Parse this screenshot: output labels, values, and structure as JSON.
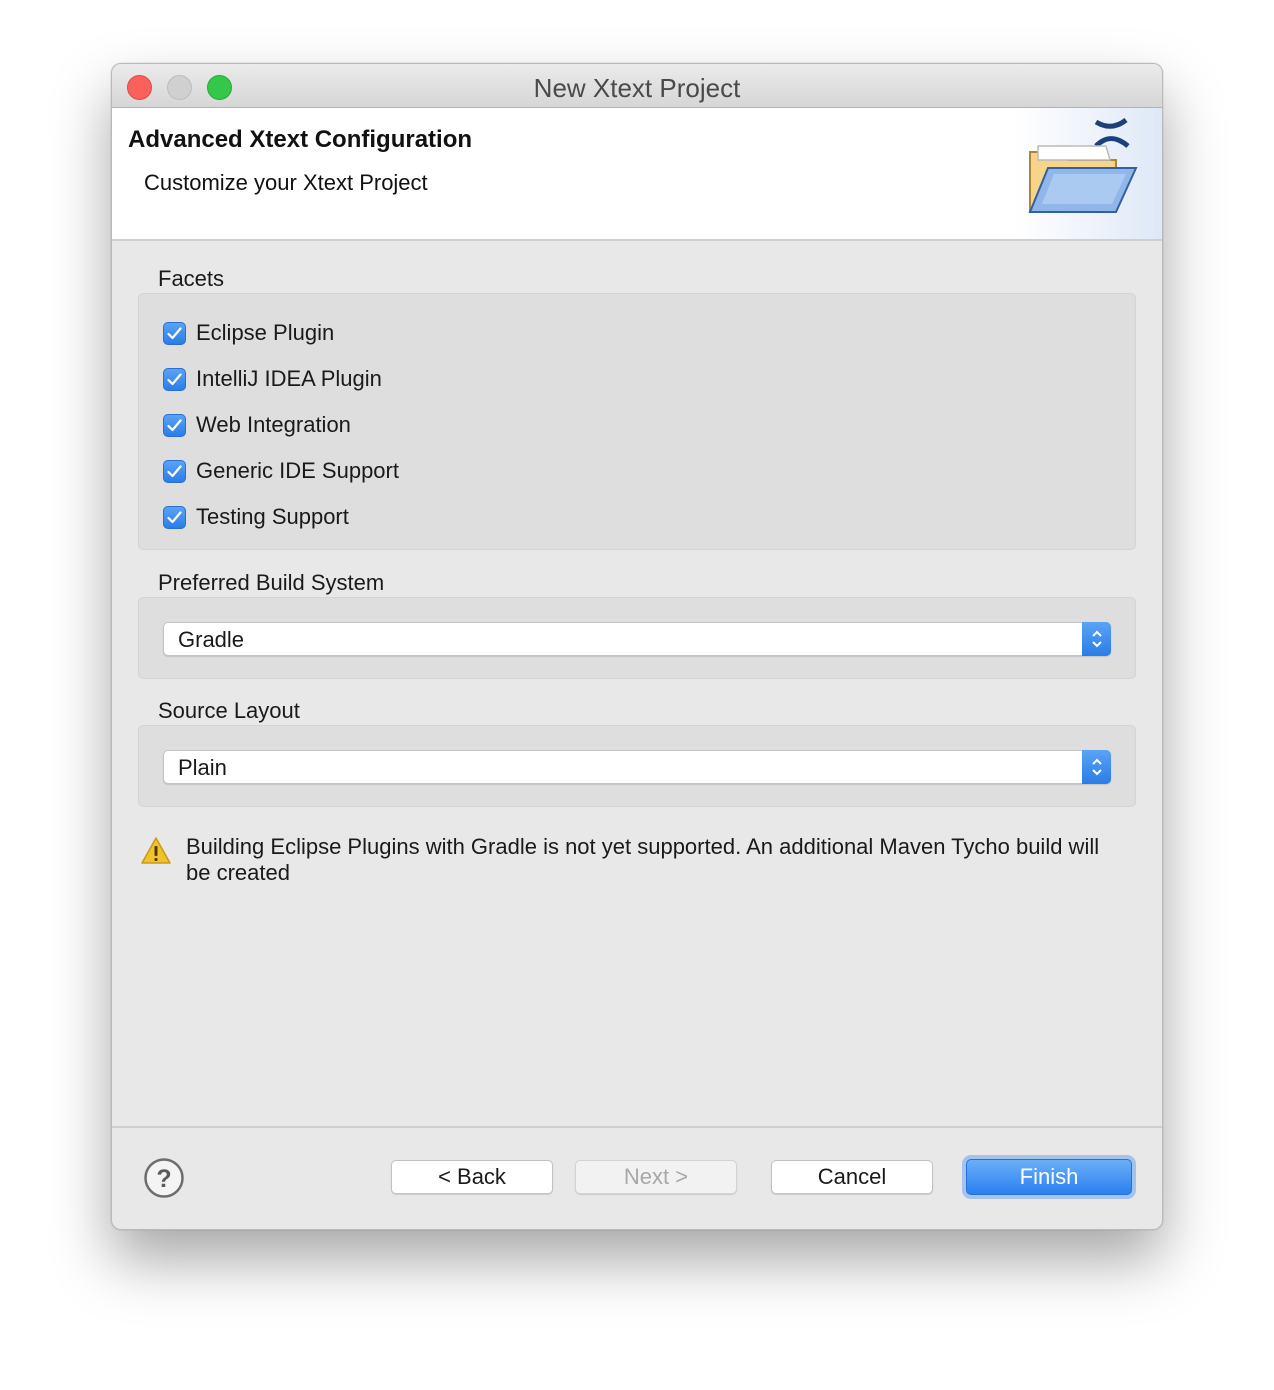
{
  "window": {
    "title": "New Xtext Project"
  },
  "header": {
    "title": "Advanced Xtext Configuration",
    "subtitle": "Customize your Xtext Project"
  },
  "facets": {
    "label": "Facets",
    "items": [
      {
        "label": "Eclipse Plugin",
        "checked": true
      },
      {
        "label": "IntelliJ IDEA Plugin",
        "checked": true
      },
      {
        "label": "Web Integration",
        "checked": true
      },
      {
        "label": "Generic IDE Support",
        "checked": true
      },
      {
        "label": "Testing Support",
        "checked": true
      }
    ]
  },
  "build_system": {
    "label": "Preferred Build System",
    "selected": "Gradle"
  },
  "source_layout": {
    "label": "Source Layout",
    "selected": "Plain"
  },
  "warning": {
    "icon": "warning-triangle-icon",
    "text": "Building Eclipse Plugins with Gradle is not yet supported. An additional Maven Tycho build will be created"
  },
  "buttons": {
    "back": "< Back",
    "next": "Next >",
    "cancel": "Cancel",
    "finish": "Finish"
  },
  "colors": {
    "accent": "#2b7ff0",
    "close": "#fc605b",
    "maximize": "#34c84a",
    "warning": "#f2c12e"
  }
}
